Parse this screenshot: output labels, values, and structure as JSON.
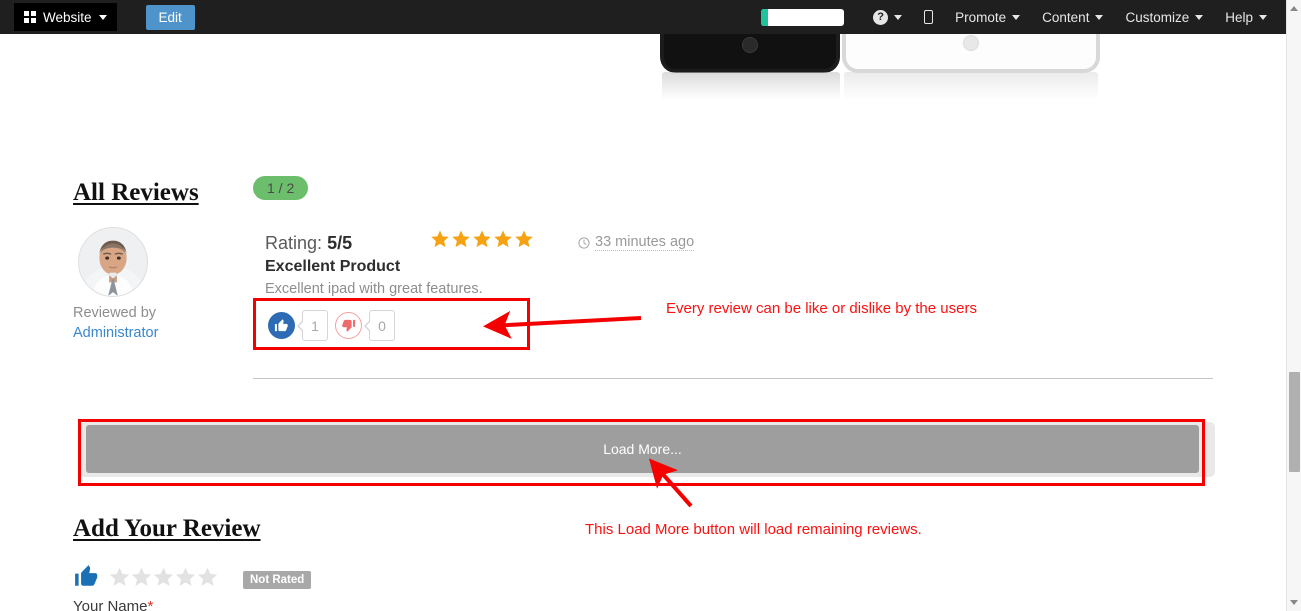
{
  "topbar": {
    "website_label": "Website",
    "website_icon": "grid-icon",
    "edit_label": "Edit",
    "help_icon": "question-mark-icon",
    "mobile_icon": "mobile-device-icon",
    "items": [
      {
        "label": "Promote",
        "caret": true
      },
      {
        "label": "Content",
        "caret": true
      },
      {
        "label": "Customize",
        "caret": true
      },
      {
        "label": "Help",
        "caret": true
      }
    ]
  },
  "reviews_section": {
    "heading": "All Reviews",
    "page_badge": "1 / 2",
    "review": {
      "avatar_name": "avatar",
      "reviewed_by_label": "Reviewed by",
      "reviewer": "Administrator",
      "rating_label": "Rating:",
      "rating_value": "5/5",
      "stars_filled": 5,
      "stars_total": 5,
      "timestamp": "33 minutes ago",
      "clock_icon": "clock-icon",
      "title": "Excellent Product",
      "body": "Excellent ipad with great features.",
      "like_icon": "thumbs-up-icon",
      "like_count": "1",
      "dislike_icon": "thumbs-down-icon",
      "dislike_count": "0"
    }
  },
  "load_more": {
    "label": "Load More..."
  },
  "add_review": {
    "heading": "Add Your Review",
    "thumb_icon": "thumbs-up-icon",
    "empty_stars": 5,
    "not_rated_badge": "Not Rated",
    "name_label": "Your Name",
    "required_marker": "*"
  },
  "annotations": [
    {
      "text": "Every review can be like or dislike by the users"
    },
    {
      "text": "This Load More button will load remaining reviews."
    }
  ],
  "colors": {
    "topbar_bg": "#1f1f1f",
    "edit_blue": "#4e93c9",
    "badge_green": "#6cbd6c",
    "star_orange": "#f5a312",
    "like_blue": "#2d6cb5",
    "dislike_red": "#f4a0a0",
    "annotation_red": "#f40000",
    "link_blue": "#3a87cd",
    "loadmore_gray": "#9e9e9e"
  }
}
